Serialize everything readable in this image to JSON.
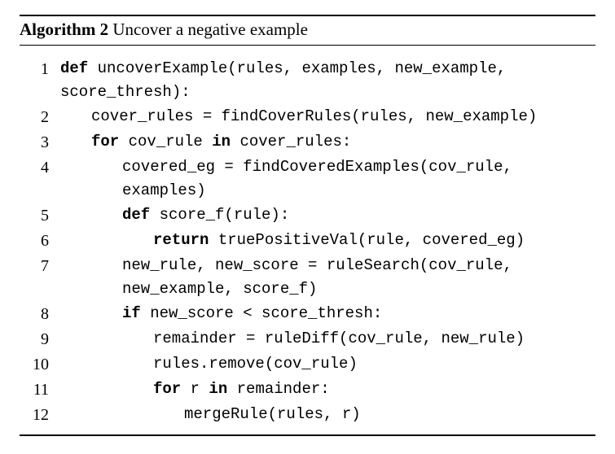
{
  "algorithm": {
    "label": "Algorithm 2",
    "caption": "Uncover a negative example"
  },
  "lines": [
    {
      "n": "1",
      "indent": 0,
      "segments": [
        {
          "t": "def ",
          "kw": true
        },
        {
          "t": "uncoverExample(rules, examples, new_example, score_thresh):"
        }
      ]
    },
    {
      "n": "2",
      "indent": 1,
      "segments": [
        {
          "t": "cover_rules = findCoverRules(rules, new_example)"
        }
      ]
    },
    {
      "n": "3",
      "indent": 1,
      "segments": [
        {
          "t": "for ",
          "kw": true
        },
        {
          "t": "cov_rule "
        },
        {
          "t": "in ",
          "kw": true
        },
        {
          "t": "cover_rules:"
        }
      ]
    },
    {
      "n": "4",
      "indent": 2,
      "segments": [
        {
          "t": "covered_eg = findCoveredExamples(cov_rule, examples)"
        }
      ]
    },
    {
      "n": "5",
      "indent": 2,
      "segments": [
        {
          "t": "def ",
          "kw": true
        },
        {
          "t": "score_f(rule):"
        }
      ]
    },
    {
      "n": "6",
      "indent": 3,
      "segments": [
        {
          "t": "return ",
          "kw": true
        },
        {
          "t": "truePositiveVal(rule, covered_eg)"
        }
      ]
    },
    {
      "n": "7",
      "indent": 2,
      "segments": [
        {
          "t": "new_rule, new_score = ruleSearch(cov_rule, new_example, score_f)"
        }
      ]
    },
    {
      "n": "8",
      "indent": 2,
      "segments": [
        {
          "t": "if ",
          "kw": true
        },
        {
          "t": "new_score < score_thresh:"
        }
      ]
    },
    {
      "n": "9",
      "indent": 3,
      "segments": [
        {
          "t": "remainder = ruleDiff(cov_rule, new_rule)"
        }
      ]
    },
    {
      "n": "10",
      "indent": 3,
      "segments": [
        {
          "t": "rules.remove(cov_rule)"
        }
      ]
    },
    {
      "n": "11",
      "indent": 3,
      "segments": [
        {
          "t": "for ",
          "kw": true
        },
        {
          "t": "r "
        },
        {
          "t": "in ",
          "kw": true
        },
        {
          "t": "remainder:"
        }
      ]
    },
    {
      "n": "12",
      "indent": 4,
      "segments": [
        {
          "t": "mergeRule(rules, r)"
        }
      ]
    }
  ],
  "indent_unit": "    "
}
